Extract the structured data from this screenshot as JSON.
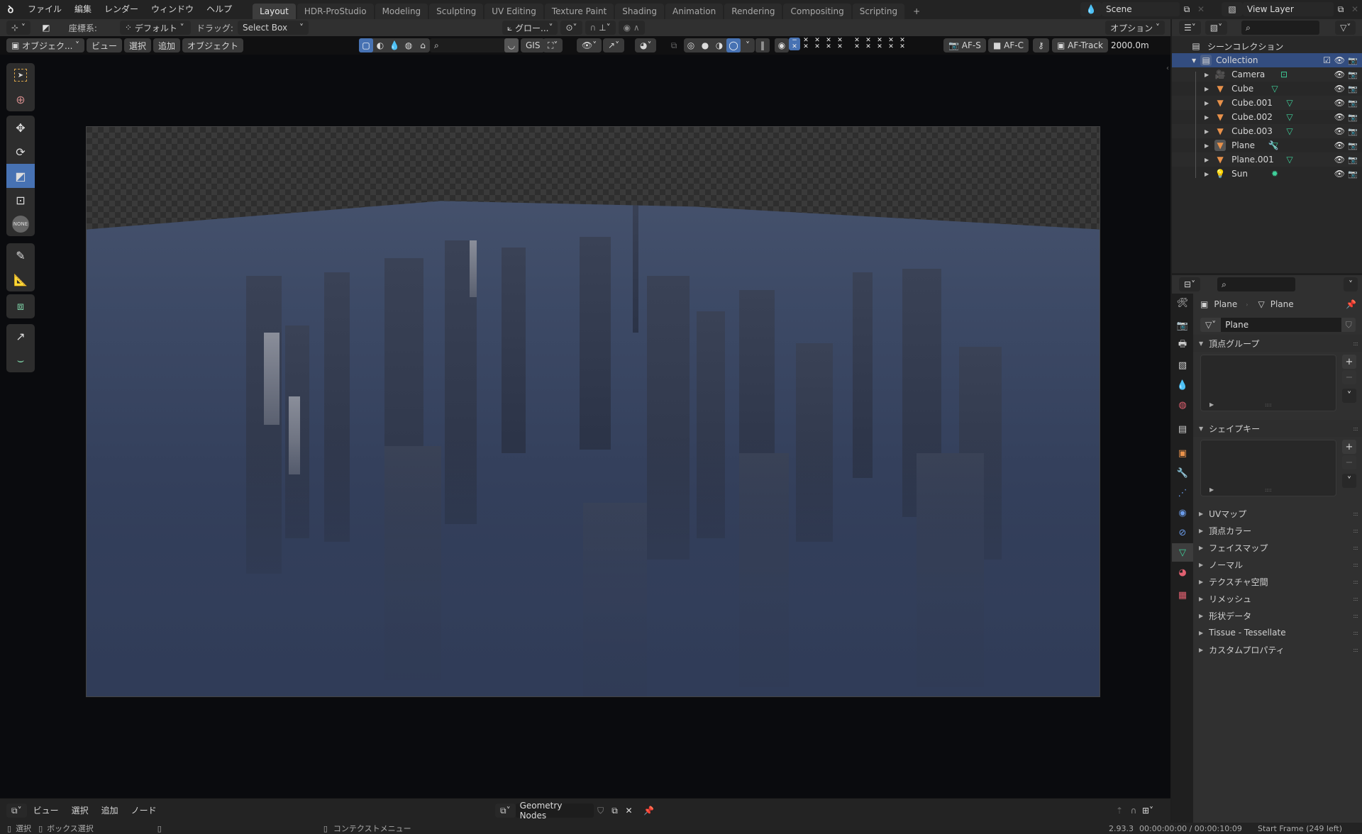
{
  "topbar": {
    "menus": [
      "ファイル",
      "編集",
      "レンダー",
      "ウィンドウ",
      "ヘルプ"
    ],
    "workspaces": [
      "Layout",
      "HDR-ProStudio",
      "Modeling",
      "Sculpting",
      "UV Editing",
      "Texture Paint",
      "Shading",
      "Animation",
      "Rendering",
      "Compositing",
      "Scripting"
    ],
    "active_workspace": "Layout",
    "add_workspace": "+",
    "scene_name": "Scene",
    "view_layer_name": "View Layer"
  },
  "tool_header": {
    "coord_label": "座標系:",
    "coord_value": "デフォルト",
    "drag_label": "ドラッグ:",
    "drag_value": "Select Box",
    "orientation_value": "グロー...",
    "options_label": "オプション"
  },
  "viewport_header": {
    "mode": "オブジェク...",
    "menus": [
      "ビュー",
      "選択",
      "追加",
      "オブジェクト"
    ],
    "gis_label": "GIS",
    "af_s": "AF-S",
    "af_c": "AF-C",
    "af_track": "AF-Track",
    "distance": "2000.0m"
  },
  "toolbar": {
    "tools": [
      "select-box",
      "cursor",
      "move",
      "rotate",
      "scale",
      "transform",
      "none",
      "annotate",
      "measure",
      "add-cube",
      "shear",
      "vertex-curve"
    ],
    "active_tool": "scale",
    "none_label": "NONE"
  },
  "node_editor": {
    "menus": [
      "ビュー",
      "選択",
      "追加",
      "ノード"
    ],
    "node_tree": "Geometry Nodes"
  },
  "statusbar": {
    "select": "選択",
    "box_select": "ボックス選択",
    "context_menu": "コンテクストメニュー",
    "version": "2.93.3",
    "time": "00:00:00:00 / 00:00:10:09",
    "frame_info": "Start Frame (249 left)"
  },
  "outliner": {
    "search_placeholder": "",
    "scene_collection": "シーンコレクション",
    "collection": "Collection",
    "objects": [
      {
        "name": "Camera",
        "type": "camera",
        "data_icon": "camera-data"
      },
      {
        "name": "Cube",
        "type": "mesh",
        "data_icon": "mesh-data"
      },
      {
        "name": "Cube.001",
        "type": "mesh",
        "data_icon": "mesh-data"
      },
      {
        "name": "Cube.002",
        "type": "mesh",
        "data_icon": "mesh-data"
      },
      {
        "name": "Cube.003",
        "type": "mesh",
        "data_icon": "mesh-data"
      },
      {
        "name": "Plane",
        "type": "mesh",
        "data_icon": "mesh-data",
        "modifier": true,
        "active": true
      },
      {
        "name": "Plane.001",
        "type": "mesh",
        "data_icon": "mesh-data"
      },
      {
        "name": "Sun",
        "type": "light",
        "data_icon": "sun-data"
      }
    ]
  },
  "properties": {
    "breadcrumb_object": "Plane",
    "breadcrumb_data": "Plane",
    "mesh_name": "Plane",
    "vertex_groups": "頂点グループ",
    "shape_keys": "シェイプキー",
    "collapsed_sections": [
      "UVマップ",
      "頂点カラー",
      "フェイスマップ",
      "ノーマル",
      "テクスチャ空間",
      "リメッシュ",
      "形状データ",
      "Tissue - Tessellate",
      "カスタムプロパティ"
    ]
  },
  "colors": {
    "accent": "#4772b3",
    "object_orange": "#e8914a",
    "data_green": "#3fd19b",
    "selected_row": "#334d80"
  }
}
